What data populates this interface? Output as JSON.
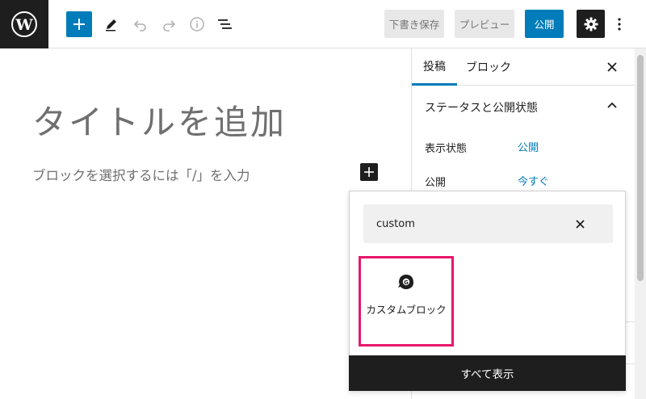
{
  "toolbar": {
    "wp_logo": "wordpress-logo",
    "save_draft_label": "下書き保存",
    "preview_label": "プレビュー",
    "publish_label": "公開",
    "accent_color": "#007cba"
  },
  "editor": {
    "title_placeholder": "タイトルを追加",
    "block_placeholder": "ブロックを選択するには「/」を入力"
  },
  "sidebar": {
    "tabs": [
      {
        "label": "投稿",
        "active": true
      },
      {
        "label": "ブロック",
        "active": false
      }
    ],
    "panel_title": "ステータスと公開状態",
    "rows": [
      {
        "label": "表示状態",
        "value": "公開"
      },
      {
        "label": "公開",
        "value": "今すぐ"
      }
    ]
  },
  "inserter": {
    "search_value": "custom",
    "results": [
      {
        "label": "カスタムブロック",
        "icon": "ghost-g-icon"
      }
    ],
    "show_all_label": "すべて表示",
    "highlight_color": "#e8176b"
  }
}
